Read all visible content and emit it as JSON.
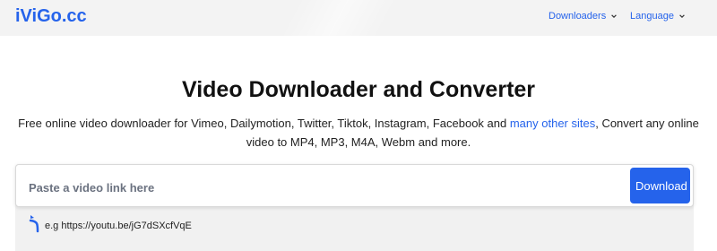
{
  "navbar": {
    "logo": "iViGo.cc",
    "items": [
      {
        "label": "Downloaders",
        "icon": "chevron-down-icon"
      },
      {
        "label": "Language",
        "icon": "chevron-down-icon"
      }
    ]
  },
  "hero": {
    "title": "Video Downloader and Converter",
    "subtitle_before_link": "Free online video downloader for Vimeo, Dailymotion, Twitter, Tiktok, Instagram, Facebook and ",
    "subtitle_link": "many other sites",
    "subtitle_after_link": ", Convert any online video to MP4, MP3, M4A, Webm and more."
  },
  "search": {
    "placeholder": "Paste a video link here",
    "value": "",
    "button_label": "Download"
  },
  "example": {
    "icon": "arrow-up-curved-icon",
    "text": "e.g https://youtu.be/jG7dSXcfVqE"
  },
  "colors": {
    "accent": "#2563eb",
    "navbar_bg": "#f3f3f3",
    "panel_bg": "#f1f1f1"
  }
}
